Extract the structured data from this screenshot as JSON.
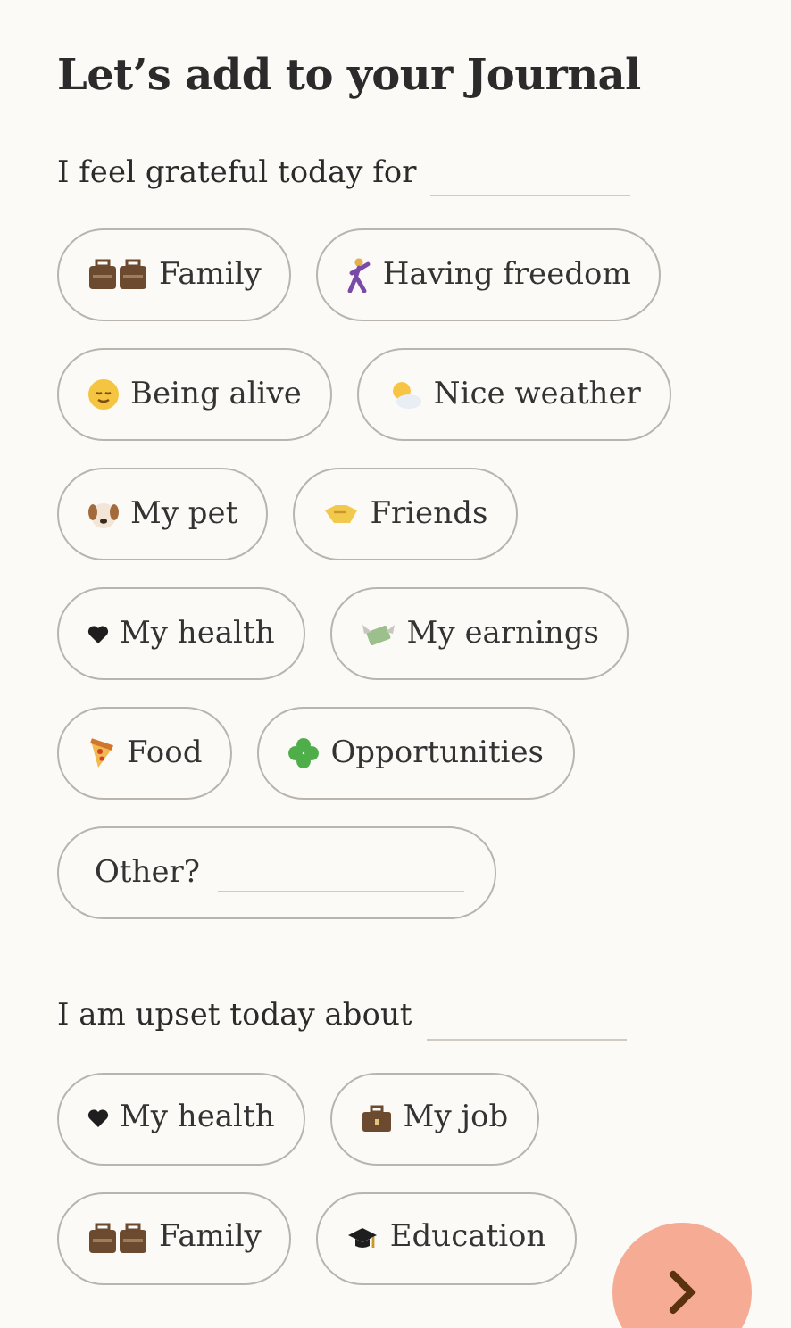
{
  "title": "Let’s add to your Journal",
  "sections": [
    {
      "prompt": "I feel grateful today for",
      "chips": [
        {
          "label": "Family"
        },
        {
          "label": "Having freedom"
        },
        {
          "label": "Being alive"
        },
        {
          "label": "Nice weather"
        },
        {
          "label": "My pet"
        },
        {
          "label": "Friends"
        },
        {
          "label": "My health"
        },
        {
          "label": "My earnings"
        },
        {
          "label": "Food"
        },
        {
          "label": "Opportunities"
        }
      ],
      "other": {
        "label": "Other?"
      }
    },
    {
      "prompt": "I am upset today about",
      "chips": [
        {
          "label": "My health"
        },
        {
          "label": "My job"
        },
        {
          "label": "Family"
        },
        {
          "label": "Education"
        }
      ]
    }
  ]
}
